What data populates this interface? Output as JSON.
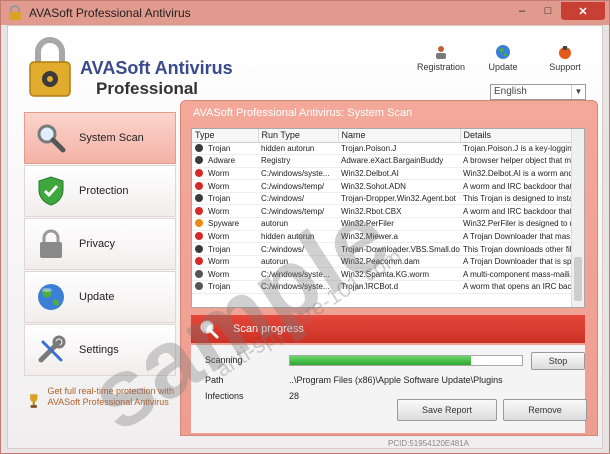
{
  "window": {
    "title": "AVASoft Professional Antivirus",
    "controls": {
      "minimize": "–",
      "maximize": "□",
      "close": "✕"
    }
  },
  "brand": {
    "line1": "AVASoft Antivirus",
    "line2": "Professional"
  },
  "top_actions": [
    {
      "label": "Registration",
      "icon": "registration-icon"
    },
    {
      "label": "Update",
      "icon": "globe-icon"
    },
    {
      "label": "Support",
      "icon": "support-icon"
    }
  ],
  "language": {
    "selected": "English"
  },
  "sidebar": {
    "items": [
      {
        "label": "System Scan",
        "icon": "magnifier-icon",
        "active": true
      },
      {
        "label": "Protection",
        "icon": "shield-icon",
        "active": false
      },
      {
        "label": "Privacy",
        "icon": "padlock-icon",
        "active": false
      },
      {
        "label": "Update",
        "icon": "globe-icon",
        "active": false
      },
      {
        "label": "Settings",
        "icon": "wrench-icon",
        "active": false
      }
    ],
    "promo": "Get full real-time protection with AVASoft Professional Antivirus"
  },
  "panel": {
    "title": "AVASoft Professional Antivirus: System Scan",
    "columns": [
      "Type",
      "Run Type",
      "Name",
      "Details"
    ],
    "rows": [
      {
        "type": "Trojan",
        "run": "hidden autorun",
        "name": "Trojan.Poison.J",
        "details": "Trojan.Poison.J is a key-loggin...",
        "color": "#3a3a3a"
      },
      {
        "type": "Adware",
        "run": "Registry",
        "name": "Adware.eXact.BargainBuddy",
        "details": "A browser helper object that m...",
        "color": "#3a3a3a"
      },
      {
        "type": "Worm",
        "run": "C:/windows/syste...",
        "name": "Win32.Delbot.AI",
        "details": "Win32.Delbot.AI is a worm and...",
        "color": "#d42a2a"
      },
      {
        "type": "Worm",
        "run": "C:/windows/temp/",
        "name": "Win32.Sohot.ADN",
        "details": "A worm and IRC backdoor that...",
        "color": "#d42a2a"
      },
      {
        "type": "Trojan",
        "run": "C:/windows/",
        "name": "Trojan-Dropper.Win32.Agent.bot",
        "details": "This Trojan is designed to insta...",
        "color": "#3a3a3a"
      },
      {
        "type": "Worm",
        "run": "C:/windows/temp/",
        "name": "Win32.Rbot.CBX",
        "details": "A worm and IRC backdoor that...",
        "color": "#d42a2a"
      },
      {
        "type": "Spyware",
        "run": "autorun",
        "name": "Win32.PerFiler",
        "details": "Win32.PerFiler is designed to r...",
        "color": "#e88a1a"
      },
      {
        "type": "Worm",
        "run": "hidden autorun",
        "name": "Win32.Miewer.a",
        "details": "A Trojan Downloader that mas...",
        "color": "#d42a2a"
      },
      {
        "type": "Trojan",
        "run": "C:/windows/",
        "name": "Trojan-Downloader.VBS.Small.do",
        "details": "This Trojan downloads other fil...",
        "color": "#3a3a3a"
      },
      {
        "type": "Worm",
        "run": "autorun",
        "name": "Win32.Peacomm.dam",
        "details": "A Trojan Downloader that is sp...",
        "color": "#d42a2a"
      },
      {
        "type": "Worm",
        "run": "C:/windows/syste...",
        "name": "Win32.Spamta.KG.worm",
        "details": "A multi-component mass-maili...",
        "color": "#555555"
      },
      {
        "type": "Trojan",
        "run": "C:/windows/syste...",
        "name": "Trojan.IRCBot.d",
        "details": "A worm that opens an IRC bac...",
        "color": "#555555"
      }
    ]
  },
  "scan": {
    "header": "Scan progress",
    "scanning_label": "Scanning",
    "progress": 0.78,
    "stop_label": "Stop",
    "path_label": "Path",
    "path_value": "..\\Program Files (x86)\\Apple Software Update\\Plugins",
    "infections_label": "Infections",
    "infections_value": "28",
    "save_report_label": "Save Report",
    "remove_label": "Remove"
  },
  "pcid": "PCID:51954120E481A",
  "watermark": {
    "main": "sample",
    "sub": "anti-spyware-101.com"
  }
}
